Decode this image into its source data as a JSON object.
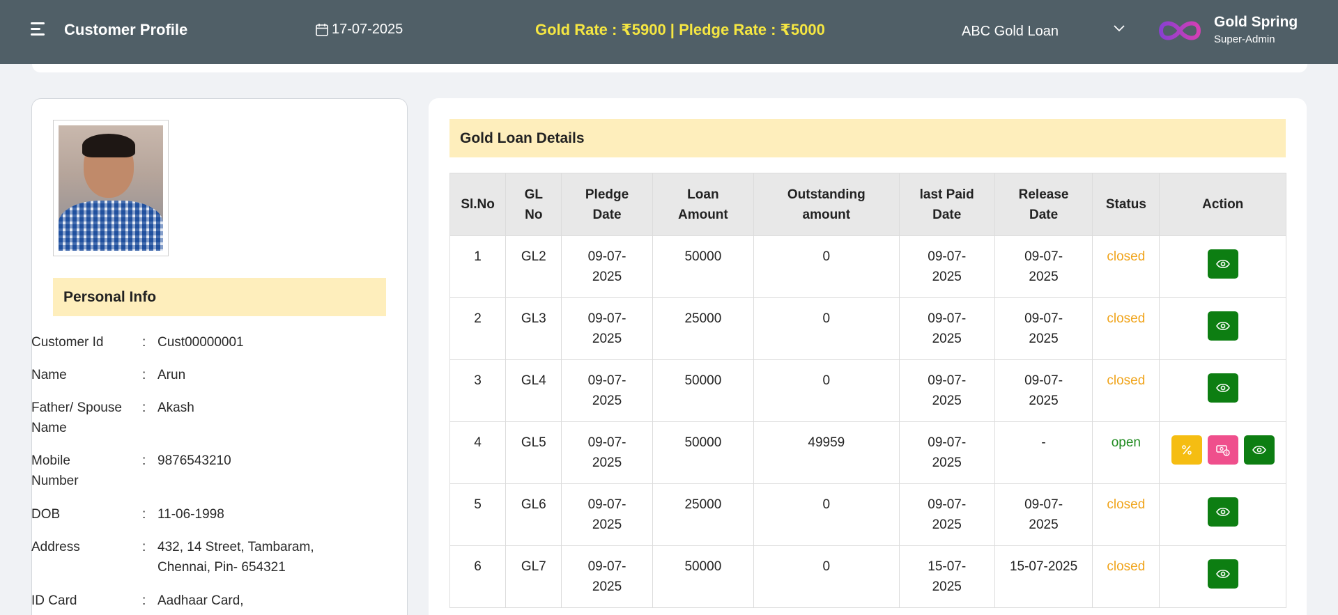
{
  "header": {
    "title": "Customer Profile",
    "date": "17-07-2025",
    "rates": "Gold Rate : ₹5900 | Pledge Rate : ₹5000",
    "company": "ABC Gold Loan",
    "brand": "Gold Spring",
    "role": "Super-Admin"
  },
  "personal_info": {
    "heading": "Personal Info",
    "rows": [
      {
        "label": "Customer Id",
        "value": "Cust00000001"
      },
      {
        "label": "Name",
        "value": "Arun"
      },
      {
        "label": "Father/ Spouse Name",
        "value": "Akash"
      },
      {
        "label": "Mobile Number",
        "value": "9876543210"
      },
      {
        "label": "DOB",
        "value": "11-06-1998"
      },
      {
        "label": "Address",
        "value": "432, 14 Street, Tambaram, Chennai, Pin- 654321"
      },
      {
        "label": "ID Card",
        "value": "Aadhaar Card,"
      }
    ]
  },
  "loans": {
    "heading": "Gold Loan Details",
    "columns": [
      "Sl.No",
      "GL No",
      "Pledge Date",
      "Loan Amount",
      "Outstanding amount",
      "last Paid Date",
      "Release Date",
      "Status",
      "Action"
    ],
    "rows": [
      {
        "sl": "1",
        "gl": "GL2",
        "pledge": "09-07-2025",
        "amount": "50000",
        "outstanding": "0",
        "last_paid": "09-07-2025",
        "release": "09-07-2025",
        "status": "closed"
      },
      {
        "sl": "2",
        "gl": "GL3",
        "pledge": "09-07-2025",
        "amount": "25000",
        "outstanding": "0",
        "last_paid": "09-07-2025",
        "release": "09-07-2025",
        "status": "closed"
      },
      {
        "sl": "3",
        "gl": "GL4",
        "pledge": "09-07-2025",
        "amount": "50000",
        "outstanding": "0",
        "last_paid": "09-07-2025",
        "release": "09-07-2025",
        "status": "closed"
      },
      {
        "sl": "4",
        "gl": "GL5",
        "pledge": "09-07-2025",
        "amount": "50000",
        "outstanding": "49959",
        "last_paid": "09-07-2025",
        "release": "-",
        "status": "open"
      },
      {
        "sl": "5",
        "gl": "GL6",
        "pledge": "09-07-2025",
        "amount": "25000",
        "outstanding": "0",
        "last_paid": "09-07-2025",
        "release": "09-07-2025",
        "status": "closed"
      },
      {
        "sl": "6",
        "gl": "GL7",
        "pledge": "09-07-2025",
        "amount": "50000",
        "outstanding": "0",
        "last_paid": "15-07-2025",
        "release": "15-07-2025",
        "status": "closed"
      }
    ]
  },
  "icons": {
    "menu": "menu-icon",
    "calendar": "calendar-icon",
    "dropdown": "chevron-down-icon",
    "logo": "infinity-logo-icon",
    "view": "eye-icon",
    "interest": "percent-icon",
    "payment": "money-icon"
  },
  "colors": {
    "topbar": "#505f67",
    "rates_text": "#f5e642",
    "section_head": "#feeebc",
    "view_button": "#0d7e12",
    "interest_button": "#f5bd12",
    "payment_button": "#ef4f8c",
    "status_closed": "#f0a41b",
    "status_open": "#1f8a1f"
  }
}
